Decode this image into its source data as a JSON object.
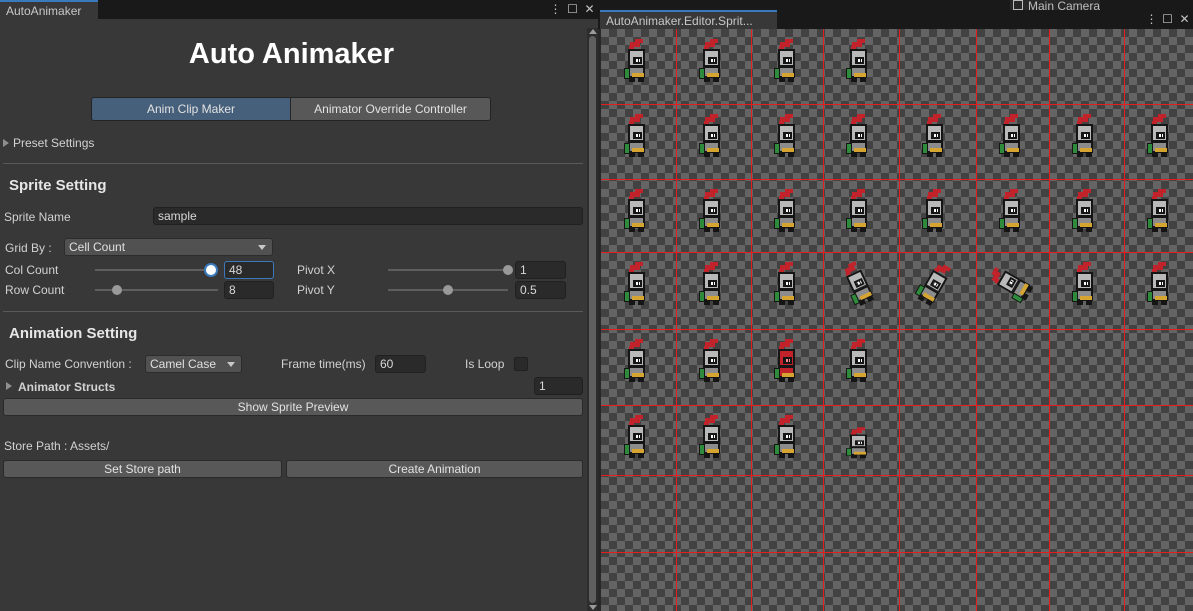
{
  "left_window": {
    "tab_label": "AutoAnimaker",
    "menu_glyph": "⋮",
    "maximize_glyph": "☐",
    "close_glyph": "✕",
    "title": "Auto Animaker",
    "tabs": [
      {
        "label": "Anim Clip Maker",
        "selected": true
      },
      {
        "label": "Animator Override Controller",
        "selected": false
      }
    ],
    "preset_settings_label": "Preset Settings",
    "sprite_setting": {
      "header": "Sprite Setting",
      "sprite_name_label": "Sprite Name",
      "sprite_name_value": "sample",
      "grid_by_label": "Grid By :",
      "grid_by_value": "Cell Count",
      "col_count_label": "Col Count",
      "col_count_value": "48",
      "col_count_slider_fraction": 0.94,
      "row_count_label": "Row Count",
      "row_count_value": "8",
      "row_count_slider_fraction": 0.18,
      "pivot_x_label": "Pivot X",
      "pivot_x_value": "1",
      "pivot_x_slider_fraction": 1.0,
      "pivot_y_label": "Pivot Y",
      "pivot_y_value": "0.5",
      "pivot_y_slider_fraction": 0.5
    },
    "animation_setting": {
      "header": "Animation Setting",
      "clip_name_convention_label": "Clip Name Convention :",
      "clip_name_convention_value": "Camel Case",
      "frame_time_label": "Frame time(ms)",
      "frame_time_value": "60",
      "is_loop_label": "Is Loop",
      "is_loop_checked": false,
      "animator_structs_label": "Animator Structs",
      "animator_structs_count": "1",
      "show_sprite_preview_label": "Show Sprite Preview"
    },
    "store_path_label": "Store Path : Assets/",
    "set_store_path_label": "Set Store path",
    "create_animation_label": "Create Animation"
  },
  "right_window": {
    "tab_label": "AutoAnimaker.Editor.Sprit...",
    "background_tab_label": "Main Camera",
    "menu_glyph": "⋮",
    "maximize_glyph": "☐",
    "close_glyph": "✕",
    "sprite_rows": [
      {
        "frames": [
          "idle",
          "idle",
          "idle",
          "idle"
        ]
      },
      {
        "frames": [
          "run",
          "run",
          "run",
          "run",
          "run",
          "run",
          "run",
          "run"
        ]
      },
      {
        "frames": [
          "walk",
          "walk",
          "walk",
          "walk",
          "walk",
          "walk",
          "walk",
          "walk"
        ]
      },
      {
        "frames": [
          "attack",
          "attack",
          "attack",
          "fall",
          "fall",
          "fall",
          "attack",
          "attack"
        ]
      },
      {
        "frames": [
          "idle",
          "idle",
          "hit",
          "idle"
        ]
      },
      {
        "frames": [
          "idle",
          "idle",
          "idle",
          "crouch"
        ]
      }
    ],
    "colors": {
      "grid_line": "#e41e1e",
      "plume": "#c2232b",
      "cape": "#2e8b3c",
      "gold": "#d6a431",
      "accent": "#3a79bb"
    }
  }
}
